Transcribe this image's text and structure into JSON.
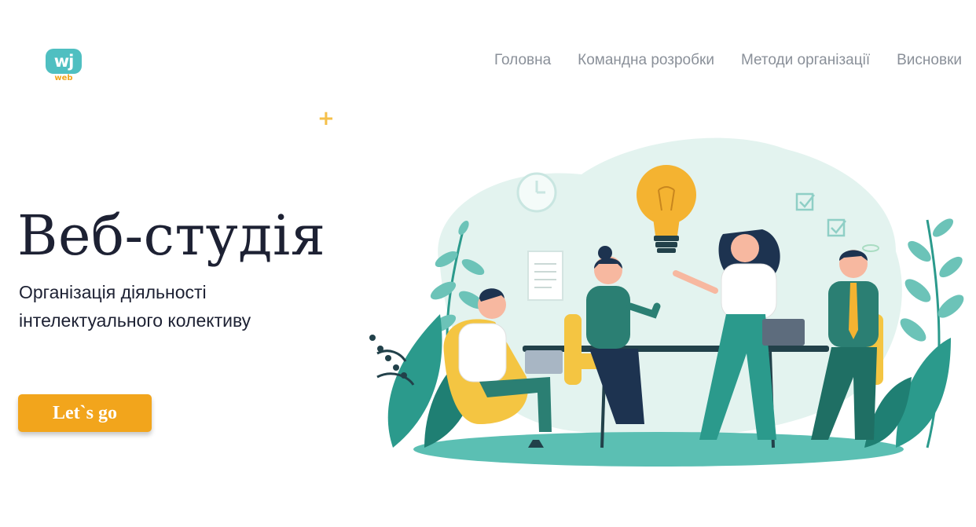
{
  "header": {
    "logo": {
      "glyph": "wj",
      "sub_label": "web"
    },
    "nav": [
      {
        "label": "Головна"
      },
      {
        "label": "Командна розробки"
      },
      {
        "label": "Методи організації"
      },
      {
        "label": "Висновки"
      }
    ]
  },
  "hero": {
    "title": "Веб-студія",
    "subtitle_line1": "Організація діяльності",
    "subtitle_line2": "інтелектуального колективу",
    "cta_label": "Let`s go"
  },
  "colors": {
    "accent_orange": "#f2a51c",
    "logo_teal": "#4fbfc1",
    "title_dark": "#1d2133",
    "nav_gray": "#8a9099",
    "illustration_teal": "#2b9a8c",
    "illustration_mint": "#e3f3ef"
  },
  "icons": {
    "sparkle": "plus-sparkle-icon"
  }
}
